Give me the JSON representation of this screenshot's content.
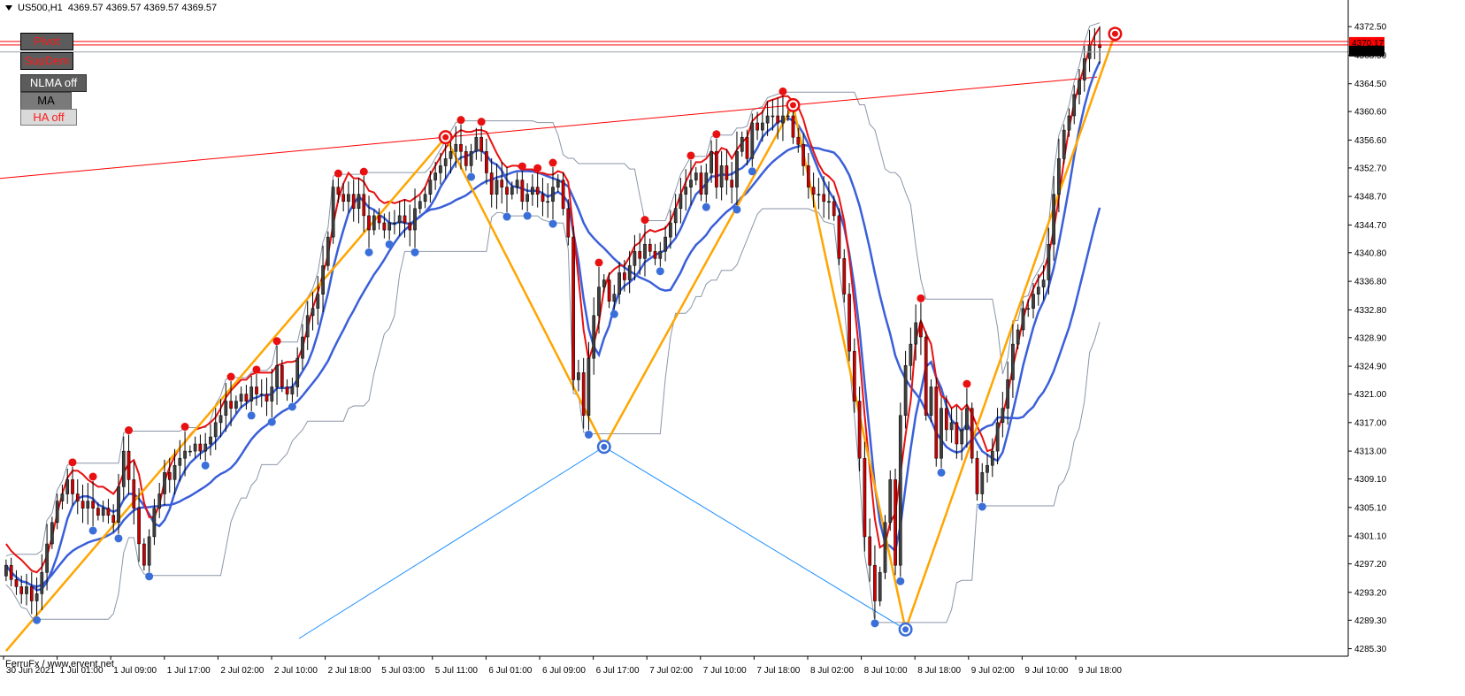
{
  "header": {
    "symbol": "US500,H1",
    "ohlc": "4369.57 4369.57 4369.57 4369.57"
  },
  "buttons": {
    "pivot": "Pivot",
    "supdem": "SupDem",
    "nlma": "NLMA off",
    "ma": "MA",
    "ha": "HA off"
  },
  "watermark": "FerruFx / www.ervent.net",
  "price_labels": {
    "current": "4369.57",
    "upper": "4370.17"
  },
  "colors": {
    "candle_up": "#404040",
    "candle_down": "#cc0000",
    "zigzag": "#ffa500",
    "ma_fast": "#3a5fd9",
    "ma_slow": "#3a5fd9",
    "nlma": "#e81010",
    "trendline": "#ff0000",
    "channel": "#8a96a8",
    "peak_marker": "#e81010",
    "trough_marker": "#3a6fd9",
    "swing_line": "#1e90ff"
  },
  "chart_data": {
    "type": "candlestick",
    "symbol": "US500",
    "timeframe": "H1",
    "ylim": [
      4284.5,
      4374.5
    ],
    "y_ticks": [
      "4372.50",
      "4368.50",
      "4364.50",
      "4360.60",
      "4356.60",
      "4352.70",
      "4348.70",
      "4344.70",
      "4340.80",
      "4336.80",
      "4332.80",
      "4328.90",
      "4324.90",
      "4321.00",
      "4317.00",
      "4313.00",
      "4309.10",
      "4305.10",
      "4301.10",
      "4297.20",
      "4293.20",
      "4289.30",
      "4285.30"
    ],
    "x_ticks": [
      "30 Jun 2021",
      "1 Jul 01:00",
      "1 Jul 09:00",
      "1 Jul 17:00",
      "2 Jul 02:00",
      "2 Jul 10:00",
      "2 Jul 18:00",
      "5 Jul 03:00",
      "5 Jul 11:00",
      "6 Jul 01:00",
      "6 Jul 09:00",
      "6 Jul 17:00",
      "7 Jul 02:00",
      "7 Jul 10:00",
      "7 Jul 18:00",
      "8 Jul 02:00",
      "8 Jul 10:00",
      "8 Jul 18:00",
      "9 Jul 02:00",
      "9 Jul 10:00",
      "9 Jul 18:00"
    ],
    "close": [
      4297,
      4295,
      4294,
      4293,
      4294,
      4292,
      4293,
      4296,
      4300,
      4303,
      4306,
      4307,
      4309,
      4307,
      4306,
      4305,
      4306,
      4305,
      4304,
      4305,
      4304,
      4303,
      4308,
      4313,
      4309,
      4305,
      4300,
      4297,
      4301,
      4305,
      4307,
      4310,
      4309,
      4311,
      4312,
      4313,
      4313,
      4314,
      4313,
      4314,
      4315,
      4317,
      4318,
      4320,
      4319,
      4320,
      4321,
      4320,
      4322,
      4321,
      4321,
      4320,
      4322,
      4325,
      4322,
      4321,
      4322,
      4326,
      4329,
      4332,
      4333,
      4335,
      4339,
      4343,
      4350,
      4349,
      4348,
      4349,
      4347,
      4349,
      4346,
      4344,
      4346,
      4345,
      4344,
      4345,
      4345,
      4346,
      4345,
      4344,
      4347,
      4348,
      4349,
      4351,
      4352,
      4353,
      4354,
      4355,
      4356,
      4355,
      4353,
      4355,
      4357,
      4355,
      4352,
      4349,
      4351,
      4350,
      4349,
      4350,
      4351,
      4348,
      4349,
      4350,
      4349,
      4348,
      4348,
      4350,
      4351,
      4347,
      4343,
      4323,
      4324,
      4318,
      4326,
      4332,
      4336,
      4337,
      4334,
      4335,
      4338,
      4337,
      4339,
      4341,
      4340,
      4342,
      4341,
      4340,
      4341,
      4343,
      4345,
      4347,
      4349,
      4350,
      4351,
      4352,
      4349,
      4352,
      4355,
      4350,
      4353,
      4351,
      4350,
      4355,
      4357,
      4354,
      4359,
      4358,
      4359,
      4360,
      4360,
      4359,
      4360,
      4360,
      4357,
      4356,
      4353,
      4350,
      4349,
      4349,
      4348,
      4348,
      4346,
      4340,
      4335,
      4327,
      4320,
      4312,
      4301,
      4297,
      4292,
      4296,
      4303,
      4309,
      4297,
      4318,
      4325,
      4328,
      4331,
      4329,
      4318,
      4322,
      4312,
      4319,
      4316,
      4317,
      4314,
      4316,
      4319,
      4312,
      4307,
      4310,
      4311,
      4313,
      4317,
      4319,
      4323,
      4328,
      4330,
      4333,
      4333,
      4335,
      4336,
      4337,
      4342,
      4349,
      4354,
      4358,
      4360,
      4363,
      4365,
      4368,
      4370,
      4370,
      4369.57
    ],
    "series": [],
    "annotations": []
  }
}
